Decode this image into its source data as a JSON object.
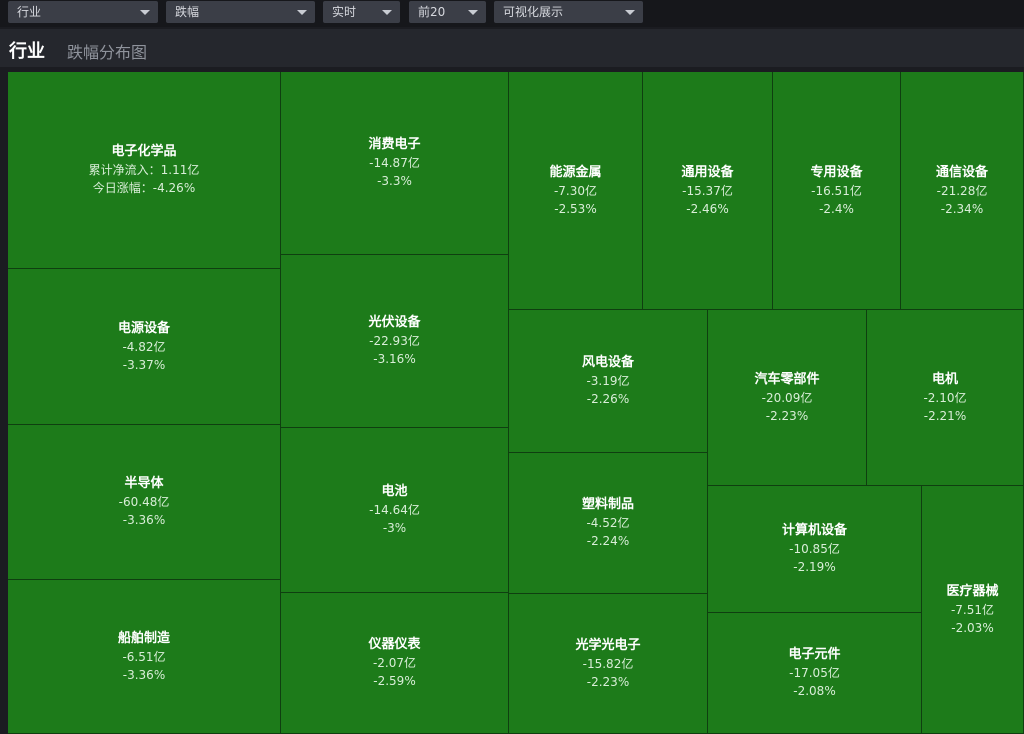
{
  "filters": [
    {
      "label": "行业"
    },
    {
      "label": "跌幅"
    },
    {
      "label": "实时"
    },
    {
      "label": "前20"
    },
    {
      "label": "可视化展示"
    }
  ],
  "header": {
    "title": "行业",
    "subtitle": "跌幅分布图"
  },
  "colors": {
    "tile": "#1d7b1a",
    "tile_border": "#0f3f10",
    "background": "#1b1c21"
  },
  "cells": [
    {
      "name": "电子化学品",
      "line1": "累计净流入：1.11亿",
      "line2": "今日涨幅：-4.26%"
    },
    {
      "name": "电源设备",
      "line1": "-4.82亿",
      "line2": "-3.37%"
    },
    {
      "name": "半导体",
      "line1": "-60.48亿",
      "line2": "-3.36%"
    },
    {
      "name": "船舶制造",
      "line1": "-6.51亿",
      "line2": "-3.36%"
    },
    {
      "name": "消费电子",
      "line1": "-14.87亿",
      "line2": "-3.3%"
    },
    {
      "name": "光伏设备",
      "line1": "-22.93亿",
      "line2": "-3.16%"
    },
    {
      "name": "电池",
      "line1": "-14.64亿",
      "line2": "-3%"
    },
    {
      "name": "仪器仪表",
      "line1": "-2.07亿",
      "line2": "-2.59%"
    },
    {
      "name": "能源金属",
      "line1": "-7.30亿",
      "line2": "-2.53%"
    },
    {
      "name": "通用设备",
      "line1": "-15.37亿",
      "line2": "-2.46%"
    },
    {
      "name": "专用设备",
      "line1": "-16.51亿",
      "line2": "-2.4%"
    },
    {
      "name": "通信设备",
      "line1": "-21.28亿",
      "line2": "-2.34%"
    },
    {
      "name": "风电设备",
      "line1": "-3.19亿",
      "line2": "-2.26%"
    },
    {
      "name": "塑料制品",
      "line1": "-4.52亿",
      "line2": "-2.24%"
    },
    {
      "name": "光学光电子",
      "line1": "-15.82亿",
      "line2": "-2.23%"
    },
    {
      "name": "汽车零部件",
      "line1": "-20.09亿",
      "line2": "-2.23%"
    },
    {
      "name": "电机",
      "line1": "-2.10亿",
      "line2": "-2.21%"
    },
    {
      "name": "计算机设备",
      "line1": "-10.85亿",
      "line2": "-2.19%"
    },
    {
      "name": "电子元件",
      "line1": "-17.05亿",
      "line2": "-2.08%"
    },
    {
      "name": "医疗器械",
      "line1": "-7.51亿",
      "line2": "-2.03%"
    }
  ]
}
